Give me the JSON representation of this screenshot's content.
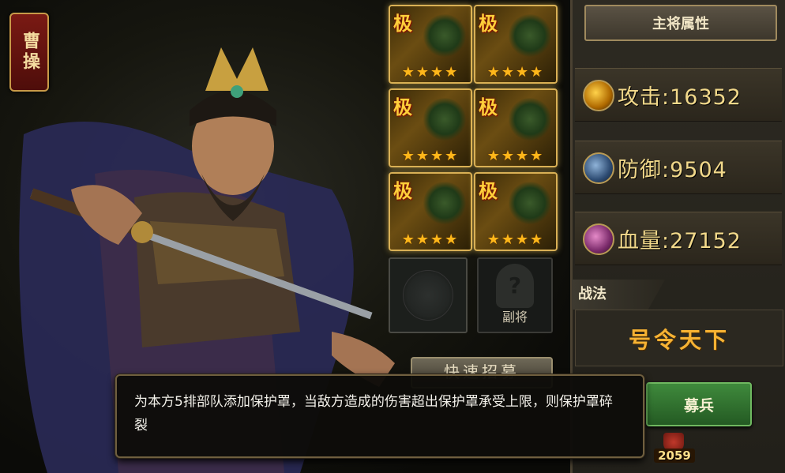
{
  "hero": {
    "name": "曹操"
  },
  "cards": [
    {
      "rank": "极",
      "stars": "★★★★"
    },
    {
      "rank": "极",
      "stars": "★★★★"
    },
    {
      "rank": "极",
      "stars": "★★★★"
    },
    {
      "rank": "极",
      "stars": "★★★★"
    },
    {
      "rank": "极",
      "stars": "★★★★"
    },
    {
      "rank": "极",
      "stars": "★★★★"
    }
  ],
  "sub_general": {
    "label": "副将"
  },
  "panel": {
    "title": "主将属性",
    "attack": "攻击:16352",
    "defense": "防御:9504",
    "hp": "血量:27152"
  },
  "tactic": {
    "heading": "战法",
    "name": "号令天下",
    "description": "为本方5排部队添加保护罩，当敌方造成的伤害超出保护罩承受上限，则保护罩碎裂"
  },
  "partial_button": {
    "label": "快速招募"
  },
  "recruit_button": {
    "label": "募兵"
  },
  "resource": {
    "count": "2059"
  },
  "colors": {
    "accent_gold": "#f1d88a",
    "tactic_orange": "#f6b233",
    "recruit_green": "#3f8a3c"
  }
}
